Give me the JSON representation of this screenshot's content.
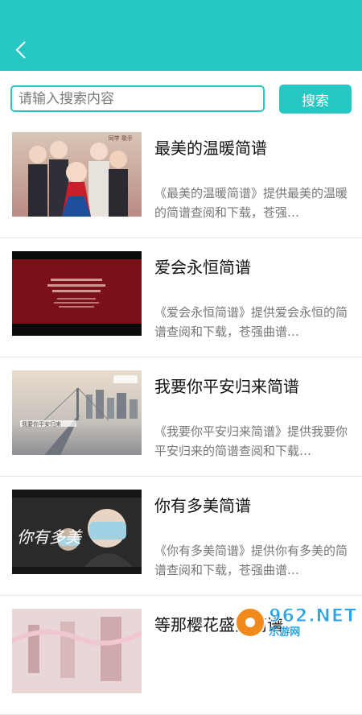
{
  "search": {
    "placeholder": "请输入搜索内容",
    "button_label": "搜索"
  },
  "items": [
    {
      "title": "最美的温暖简谱",
      "description": "《最美的温暖简谱》提供最美的温暖的简谱查阅和下载，苍强…"
    },
    {
      "title": "爱会永恒简谱",
      "description": "《爱会永恒简谱》提供爱会永恒的简谱查阅和下载，苍强曲谱…"
    },
    {
      "title": "我要你平安归来简谱",
      "description": "《我要你平安归来简谱》提供我要你平安归来的简谱查阅和下载…"
    },
    {
      "title": "你有多美简谱",
      "description": "《你有多美简谱》提供你有多美的简谱查阅和下载，苍强曲谱…"
    },
    {
      "title": "等那樱花盛开简谱",
      "description": ""
    }
  ],
  "thumbnails": {
    "t1_text": "同学 歌手",
    "t3_caption": "我要你平安归来",
    "t4_caption": "你有多美"
  },
  "watermark": {
    "number": "962.NET",
    "site": "乐游网"
  },
  "colors": {
    "accent": "#27c7c4",
    "watermark_blue": "#2aa5e6",
    "watermark_orange": "#f08a1c"
  }
}
